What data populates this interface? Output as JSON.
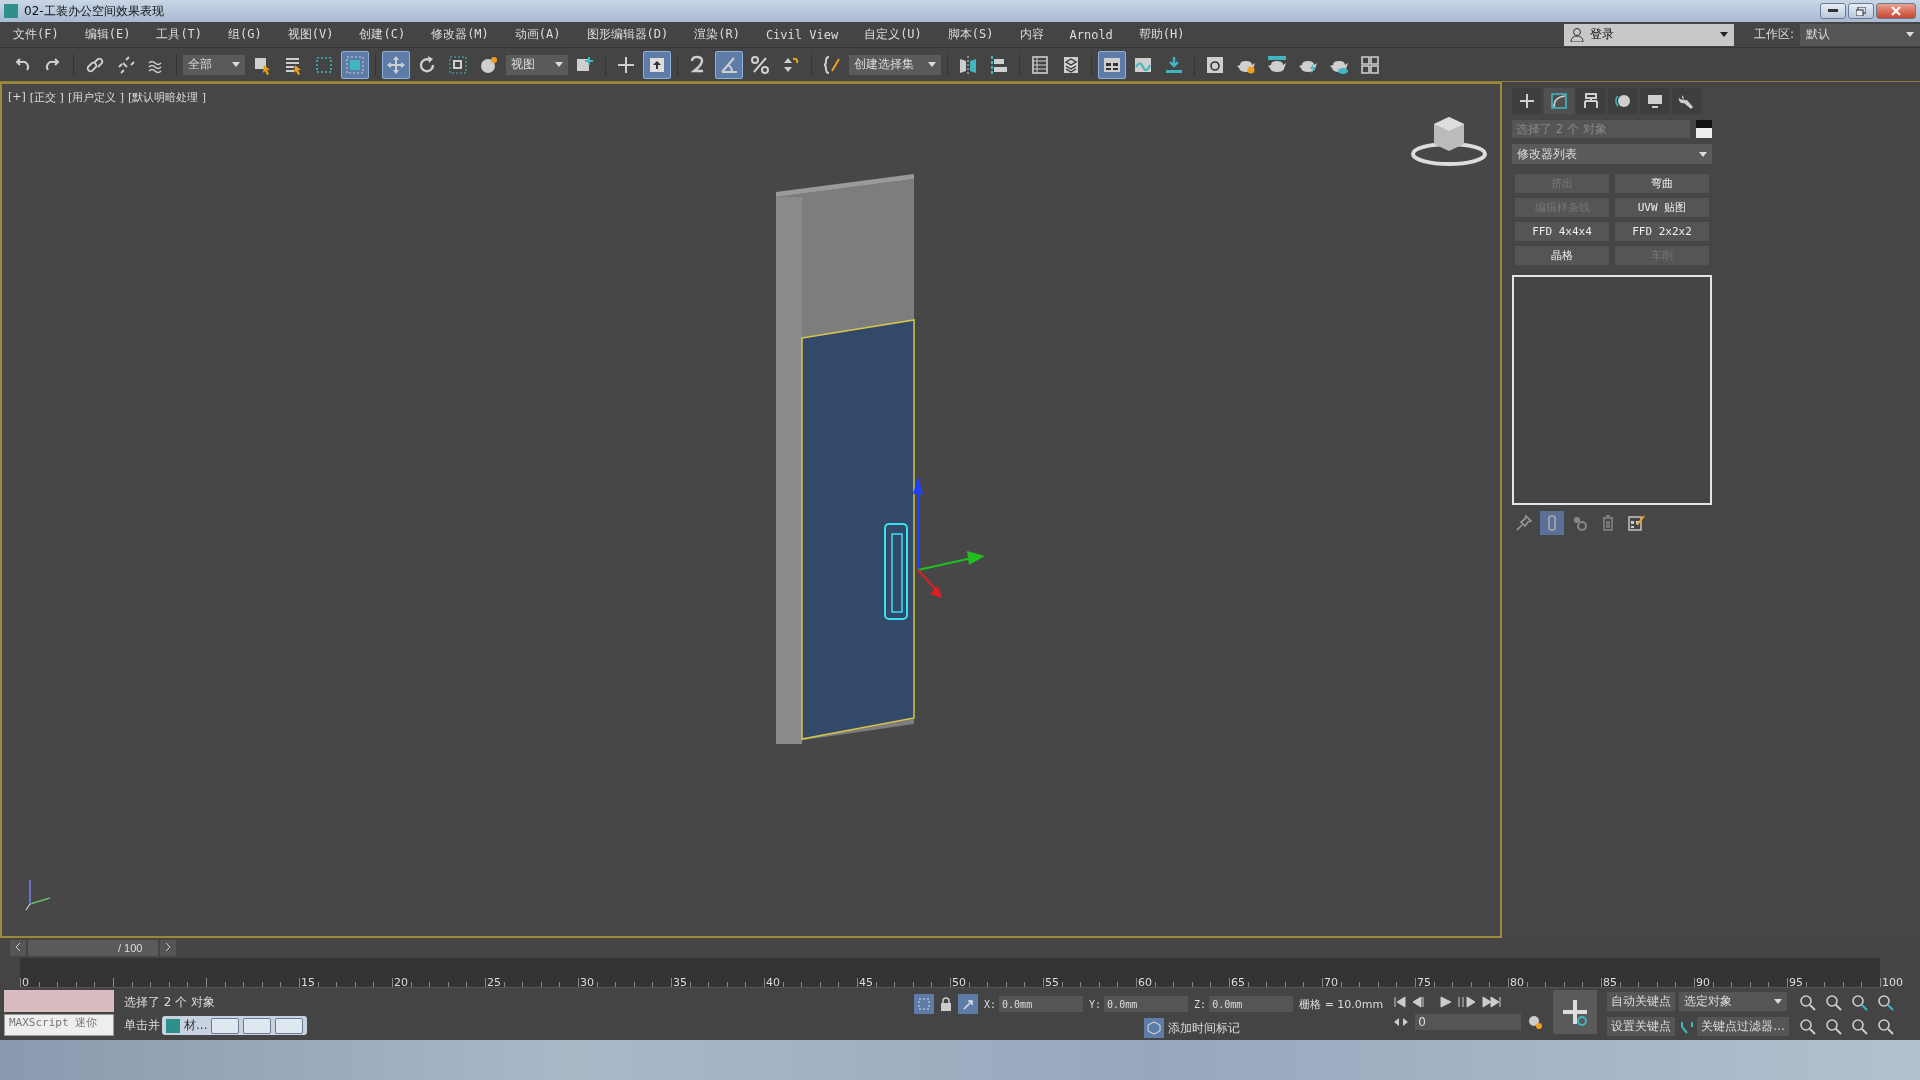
{
  "window": {
    "title": "02-工装办公空间效果表现"
  },
  "menu": [
    "文件(F)",
    "编辑(E)",
    "工具(T)",
    "组(G)",
    "视图(V)",
    "创建(C)",
    "修改器(M)",
    "动画(A)",
    "图形编辑器(D)",
    "渲染(R)",
    "Civil View",
    "自定义(U)",
    "脚本(S)",
    "内容",
    "Arnold",
    "帮助(H)"
  ],
  "account": {
    "label": "登录"
  },
  "workspace": {
    "label": "工作区:",
    "value": "默认"
  },
  "toolbar": [
    {
      "kind": "undo",
      "selected": false
    },
    {
      "kind": "redo",
      "selected": false
    },
    {
      "kind": "sep"
    },
    {
      "kind": "link",
      "selected": false
    },
    {
      "kind": "unlink",
      "selected": false
    },
    {
      "kind": "bind",
      "selected": false
    },
    {
      "kind": "sep"
    },
    {
      "kind": "dropdown",
      "value": "全部"
    },
    {
      "kind": "select",
      "selected": false
    },
    {
      "kind": "select-list",
      "selected": false
    },
    {
      "kind": "rect-select",
      "selected": false
    },
    {
      "kind": "window-select",
      "selected": true
    },
    {
      "kind": "sep"
    },
    {
      "kind": "move",
      "selected": true
    },
    {
      "kind": "rotate",
      "selected": false
    },
    {
      "kind": "scale",
      "selected": false
    },
    {
      "kind": "sphere",
      "selected": false
    },
    {
      "kind": "dropdown",
      "value": "视图"
    },
    {
      "kind": "pivot",
      "selected": false
    },
    {
      "kind": "sep"
    },
    {
      "kind": "cross",
      "selected": false
    },
    {
      "kind": "key-arrow",
      "selected": true
    },
    {
      "kind": "sep"
    },
    {
      "kind": "snap",
      "selected": false
    },
    {
      "kind": "angle",
      "selected": true
    },
    {
      "kind": "percent",
      "selected": false
    },
    {
      "kind": "spinner",
      "selected": false
    },
    {
      "kind": "sep"
    },
    {
      "kind": "brace",
      "selected": false
    },
    {
      "kind": "dropdown",
      "value": "创建选择集"
    },
    {
      "kind": "sep"
    },
    {
      "kind": "mirror",
      "selected": false
    },
    {
      "kind": "align",
      "selected": false
    },
    {
      "kind": "sep"
    },
    {
      "kind": "table",
      "selected": false
    },
    {
      "kind": "layers",
      "selected": false
    },
    {
      "kind": "sep"
    },
    {
      "kind": "ribbon",
      "selected": true
    },
    {
      "kind": "curve",
      "selected": false
    },
    {
      "kind": "download",
      "selected": false
    },
    {
      "kind": "sep"
    },
    {
      "kind": "material",
      "selected": false
    },
    {
      "kind": "teapot-gear",
      "selected": false
    },
    {
      "kind": "teapot-frame",
      "selected": false
    },
    {
      "kind": "teapot-bolt",
      "selected": false
    },
    {
      "kind": "teapot-cloud",
      "selected": false
    },
    {
      "kind": "grid",
      "selected": false
    }
  ],
  "viewport": {
    "labels": [
      "[+]",
      "[正交 ]",
      "[用户定义 ]",
      "[默认明暗处理 ]"
    ]
  },
  "command_panel": {
    "tabs": [
      {
        "kind": "create",
        "selected": false
      },
      {
        "kind": "modify",
        "selected": true
      },
      {
        "kind": "hierarchy",
        "selected": false
      },
      {
        "kind": "motion",
        "selected": false
      },
      {
        "kind": "display",
        "selected": false
      },
      {
        "kind": "utilities",
        "selected": false
      }
    ],
    "name_field": {
      "value": "选择了 2 个 对象",
      "disabled": true
    },
    "modifier_list": {
      "value": "修改器列表"
    },
    "modifier_buttons": [
      {
        "label": "挤出",
        "disabled": true
      },
      {
        "label": "弯曲",
        "disabled": false
      },
      {
        "label": "编辑样条线",
        "disabled": true
      },
      {
        "label": "UVW 贴图",
        "disabled": false
      },
      {
        "label": "FFD 4x4x4",
        "disabled": false
      },
      {
        "label": "FFD 2x2x2",
        "disabled": false
      },
      {
        "label": "晶格",
        "disabled": false
      },
      {
        "label": "车削",
        "disabled": true
      }
    ],
    "stack_tools": [
      {
        "kind": "pin",
        "selected": false
      },
      {
        "kind": "show-end",
        "selected": true
      },
      {
        "kind": "unique",
        "selected": false
      },
      {
        "kind": "remove",
        "selected": false
      },
      {
        "kind": "configure",
        "selected": false
      }
    ]
  },
  "time_slider": {
    "value": "/ 100"
  },
  "ruler": [
    "0",
    "15",
    "20",
    "25",
    "30",
    "35",
    "40",
    "45",
    "50",
    "55",
    "60",
    "65",
    "70",
    "75",
    "80",
    "85",
    "90",
    "95",
    "100"
  ],
  "status": {
    "maxscript": "MAXScript 迷你",
    "selection": "选择了 2 个 对象",
    "prompt": "单击并",
    "taskbar_window": {
      "title": "材..."
    },
    "coords": [
      {
        "label": "X:",
        "value": "0.0mm"
      },
      {
        "label": "Y:",
        "value": "0.0mm"
      },
      {
        "label": "Z:",
        "value": "0.0mm"
      }
    ],
    "grid": "栅格 = 10.0mm",
    "time_tag": "添加时间标记",
    "frame": "0",
    "auto_key": "自动关键点",
    "key_target": "选定对象",
    "set_key": "设置关键点",
    "key_filters": "关键点过滤器..."
  }
}
